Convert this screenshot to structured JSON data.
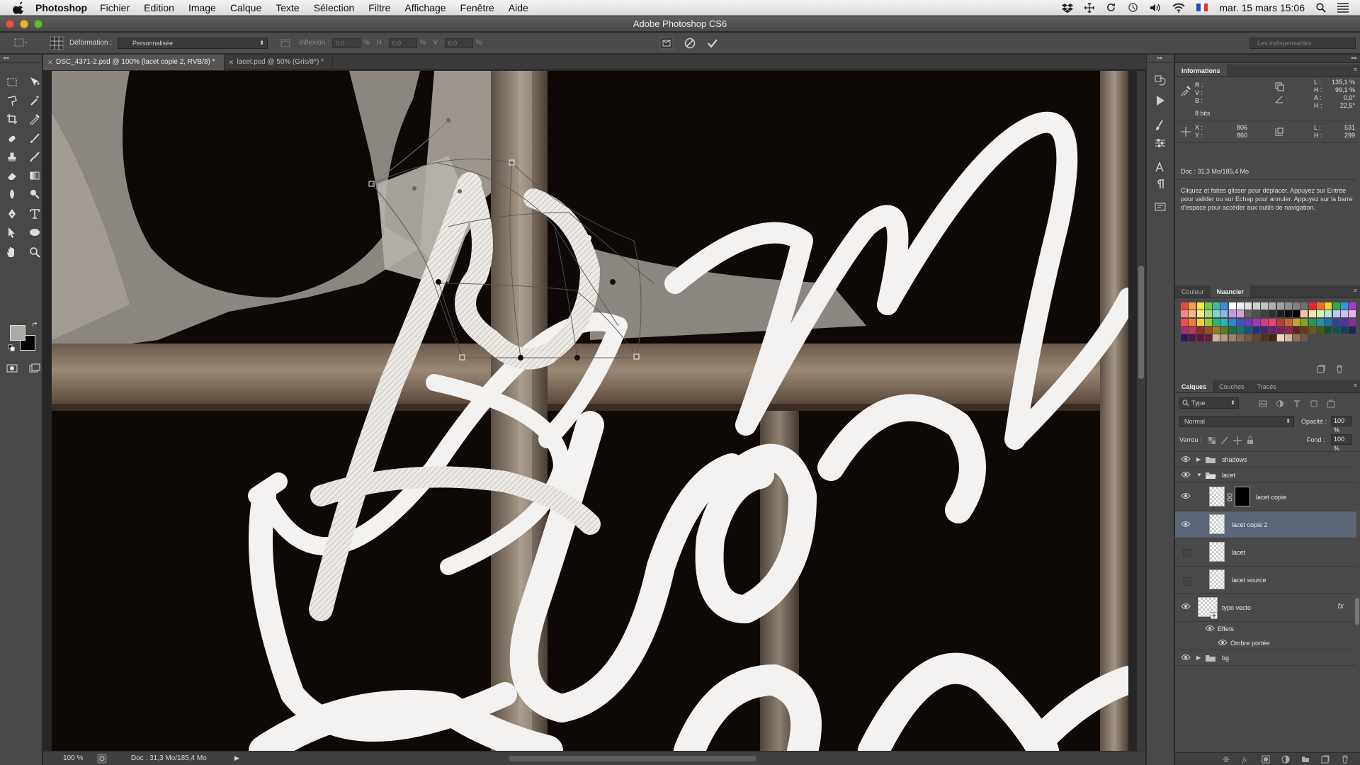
{
  "menubar": {
    "app_name": "Photoshop",
    "items": [
      "Fichier",
      "Edition",
      "Image",
      "Calque",
      "Texte",
      "Sélection",
      "Filtre",
      "Affichage",
      "Fenêtre",
      "Aide"
    ],
    "clock": "mar. 15 mars  15:06"
  },
  "window": {
    "title": "Adobe Photoshop CS6"
  },
  "options": {
    "mode_label": "Déformation :",
    "mode_value": "Personnalisée",
    "inflexion_label": "Inflexion :",
    "inflexion_value": "0,0",
    "pct": "%",
    "h_label": "H :",
    "h_value": "0,0",
    "v_label": "V :",
    "v_value": "0,0",
    "workspace": "Les indispensables"
  },
  "tabs": [
    {
      "label": "DSC_4371-2.psd @ 100% (lacet copie 2, RVB/8) *",
      "active": true
    },
    {
      "label": "lacet.psd @ 50% (Gris/8*) *",
      "active": false
    }
  ],
  "status": {
    "zoom": "100 %",
    "doc": "Doc : 31,3 Mo/185,4 Mo"
  },
  "info_panel": {
    "tab": "Informations",
    "rgb": {
      "r_key": "R :",
      "v_key": "V :",
      "b_key": "B :"
    },
    "lab": [
      {
        "k": "L :",
        "v": "135,1 %"
      },
      {
        "k": "H :",
        "v": "99,1 %"
      },
      {
        "k": "A :",
        "v": "0,0°"
      },
      {
        "k": "H :",
        "v": "22,5°"
      }
    ],
    "bits": "8 bits",
    "xy": [
      {
        "k": "X :",
        "v": "806"
      },
      {
        "k": "Y :",
        "v": "860"
      }
    ],
    "wh": [
      {
        "k": "L :",
        "v": "531"
      },
      {
        "k": "H :",
        "v": "299"
      }
    ],
    "doc": "Doc : 31,3 Mo/185,4 Mo",
    "hint": "Cliquez et faites glisser pour déplacer. Appuyez sur Entrée pour valider ou sur Echap pour annuler. Appuyez sur la barre d'espace pour accéder aux outils de navigation."
  },
  "swatch_panel": {
    "tabs": [
      "Couleur",
      "Nuancier"
    ],
    "active": 1
  },
  "swatches": [
    "#e64a3b",
    "#f2a33b",
    "#f5e642",
    "#6ccb49",
    "#3fb8a5",
    "#3c8fd8",
    "#ffffff",
    "#f0f0f0",
    "#e0e0e0",
    "#d0d0d0",
    "#c0c0c0",
    "#b0b0b0",
    "#a0a0a0",
    "#909090",
    "#808080",
    "#707070",
    "#e02a2a",
    "#f46a2a",
    "#f8d22a",
    "#2ab03a",
    "#2a9ad8",
    "#a43ad0",
    "#f08a8a",
    "#f6b97a",
    "#f7ec8a",
    "#a4dc7e",
    "#7ed6c8",
    "#8ab8e8",
    "#b4a0e0",
    "#d8a0d8",
    "#606060",
    "#505050",
    "#404040",
    "#303030",
    "#202020",
    "#101010",
    "#000000",
    "#f6c2a2",
    "#f9e3b0",
    "#d9f0b0",
    "#b2e6d8",
    "#b4cdef",
    "#c9c2ec",
    "#eab2dc",
    "#ef4d4d",
    "#f17b36",
    "#f4cf2f",
    "#9ccd2d",
    "#2cb66a",
    "#2ab6b9",
    "#2b87d2",
    "#3a54c2",
    "#6b3cbd",
    "#a936b6",
    "#d03a8c",
    "#e8436a",
    "#c23b3b",
    "#c56430",
    "#c4a72a",
    "#7fa626",
    "#249459",
    "#239397",
    "#236eab",
    "#30449e",
    "#57319a",
    "#8a2d95",
    "#a92f71",
    "#bc3756",
    "#942c2c",
    "#965024",
    "#957f1f",
    "#607d1c",
    "#1b7044",
    "#1b7073",
    "#1a5382",
    "#253478",
    "#42256f",
    "#69226d",
    "#811f55",
    "#8e2a41",
    "#6a1f1f",
    "#6b3a1a",
    "#6a5a16",
    "#445914",
    "#135031",
    "#135052",
    "#13405f",
    "#1b2655",
    "#2f1a50",
    "#4b184e",
    "#5c163c",
    "#65202e",
    "#c8b4a0",
    "#b49a7e",
    "#a0806a",
    "#8a6a54",
    "#765840",
    "#62462e",
    "#4e341e",
    "#3c2612",
    "#e8d8c0",
    "#d4b896",
    "#8c7260",
    "#6e5644"
  ],
  "layers_panel": {
    "tabs": [
      "Calques",
      "Couches",
      "Tracés"
    ],
    "active": 0,
    "filter": "Type",
    "blend": "Normal",
    "opacity_label": "Opacité :",
    "opacity": "100 %",
    "lock_label": "Verrou :",
    "fill_label": "Fond :",
    "fill": "100 %",
    "layers": [
      {
        "name": "shadows",
        "kind": "group",
        "visible": true,
        "expanded": false,
        "indent": 0
      },
      {
        "name": "lacet",
        "kind": "group",
        "visible": true,
        "expanded": true,
        "indent": 0
      },
      {
        "name": "lacet copie",
        "kind": "layer",
        "visible": true,
        "indent": 1,
        "mask": true
      },
      {
        "name": "lacet copie 2",
        "kind": "layer",
        "visible": true,
        "indent": 1,
        "selected": true
      },
      {
        "name": "lacet",
        "kind": "layer",
        "visible": false,
        "indent": 1
      },
      {
        "name": "lacet source",
        "kind": "layer",
        "visible": false,
        "indent": 1
      },
      {
        "name": "typo vecto",
        "kind": "layer",
        "visible": true,
        "indent": 0,
        "fx": "fx"
      },
      {
        "name": "Effets",
        "kind": "effects",
        "visible": true,
        "indent": 1
      },
      {
        "name": "Ombre portée",
        "kind": "effect",
        "visible": true,
        "indent": 2
      },
      {
        "name": "bg",
        "kind": "group",
        "visible": true,
        "expanded": false,
        "indent": 0
      }
    ]
  },
  "colors": {
    "panel_bg": "#4a4a4a",
    "selected_layer": "#5b6677",
    "canvas_dark": "#0e0907",
    "ribbon": "#f4f2f0"
  }
}
